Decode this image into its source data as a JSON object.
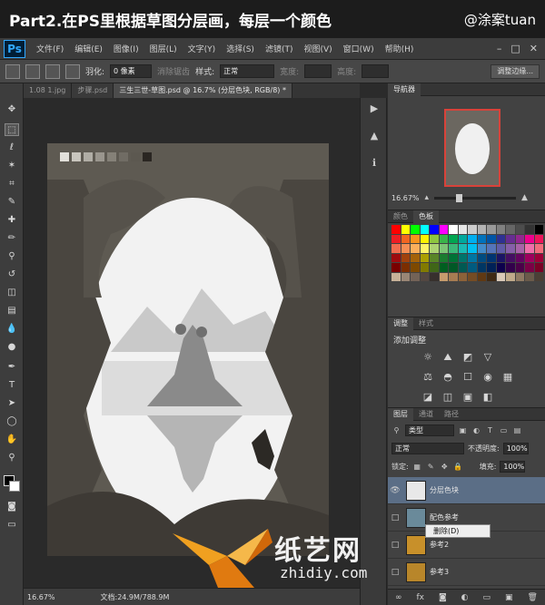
{
  "caption": {
    "title": "Part2.在PS里根据草图分层画，每层一个颜色",
    "author": "@涂案tuan"
  },
  "menubar": {
    "logo": "Ps",
    "items": [
      "文件(F)",
      "编辑(E)",
      "图像(I)",
      "图层(L)",
      "文字(Y)",
      "选择(S)",
      "滤镜(T)",
      "视图(V)",
      "窗口(W)",
      "帮助(H)"
    ]
  },
  "options": {
    "feather_label": "羽化:",
    "feather_value": "0 像素",
    "antialias": "消除锯齿",
    "style_label": "样式:",
    "style_value": "正常",
    "width_label": "宽度:",
    "height_label": "高度:",
    "refine_button": "调整边缘..."
  },
  "tabs": [
    {
      "label": "1.08 1.jpg",
      "active": false
    },
    {
      "label": "步骤.psd",
      "active": false
    },
    {
      "label": "三生三世-草图.psd @ 16.7% (分层色块, RGB/8) *",
      "active": true
    }
  ],
  "status": {
    "zoom": "16.67%",
    "doc": "文档:24.9M/788.9M"
  },
  "navigator": {
    "tab": "导航器",
    "zoom": "16.67%"
  },
  "swatch_panel": {
    "tabs": [
      {
        "label": "颜色",
        "active": false
      },
      {
        "label": "色板",
        "active": true
      }
    ],
    "colors": [
      "#ff0000",
      "#ffff00",
      "#00ff00",
      "#00ffff",
      "#0000ff",
      "#ff00ff",
      "#ffffff",
      "#e6e6e6",
      "#cccccc",
      "#b3b3b3",
      "#999999",
      "#808080",
      "#666666",
      "#4d4d4d",
      "#333333",
      "#000000",
      "#ee1d24",
      "#f26522",
      "#f7941d",
      "#fff200",
      "#8dc63f",
      "#39b54a",
      "#00a651",
      "#00a99d",
      "#00aeef",
      "#0072bc",
      "#0054a6",
      "#2e3192",
      "#662d91",
      "#92278f",
      "#ec008c",
      "#ed145b",
      "#f26c4f",
      "#f68e55",
      "#fbaf5c",
      "#fff467",
      "#acd372",
      "#7cc576",
      "#3bb878",
      "#1abbb4",
      "#00bff3",
      "#438ccb",
      "#5574b9",
      "#605ca8",
      "#855fa8",
      "#a763a8",
      "#f06eaa",
      "#f26d7d",
      "#9e0b0f",
      "#a0410d",
      "#a36209",
      "#aba000",
      "#598527",
      "#1a7b30",
      "#007236",
      "#00746b",
      "#0076a3",
      "#004b80",
      "#003471",
      "#1b1464",
      "#440e62",
      "#630460",
      "#9e005d",
      "#9e0039",
      "#790000",
      "#7b2e00",
      "#7d4900",
      "#827b00",
      "#406618",
      "#005e20",
      "#005826",
      "#005952",
      "#005b7f",
      "#003663",
      "#002157",
      "#0d004c",
      "#32004b",
      "#4b0049",
      "#7b0046",
      "#7a0026",
      "#c7b299",
      "#998675",
      "#736357",
      "#534741",
      "#37302d",
      "#c69c6d",
      "#a67c52",
      "#8c6239",
      "#754c24",
      "#603913",
      "#3f2a14",
      "#d9c9b8",
      "#bfa98a",
      "#8f7a63",
      "#6a5a4a",
      "#4b3f35"
    ]
  },
  "adjustments": {
    "tabs": [
      {
        "label": "调整",
        "active": true
      },
      {
        "label": "样式",
        "active": false
      }
    ],
    "title": "添加调整",
    "icons": [
      "☼",
      "⛰",
      "◩",
      "▽",
      "",
      "⚖",
      "◓",
      "☐",
      "◉",
      "▦",
      "",
      "",
      "◪",
      "◫",
      "▣",
      "◧",
      "",
      "",
      "",
      ""
    ]
  },
  "layers": {
    "tabs": [
      {
        "label": "图层",
        "active": true
      },
      {
        "label": "通道",
        "active": false
      },
      {
        "label": "路径",
        "active": false
      }
    ],
    "filter_label": "类型",
    "blend_mode": "正常",
    "opacity_label": "不透明度:",
    "opacity_value": "100%",
    "lock_label": "锁定:",
    "fill_label": "填充:",
    "fill_value": "100%",
    "rows": [
      {
        "name": "分层色块",
        "visible": true,
        "selected": true,
        "thumb": "#e8e8e8"
      },
      {
        "name": "配色参考",
        "visible": false,
        "selected": false,
        "thumb": "#6a8a9a"
      },
      {
        "name": "参考2",
        "visible": false,
        "selected": false,
        "thumb": "#c8902a"
      },
      {
        "name": "参考3",
        "visible": false,
        "selected": false,
        "thumb": "#b8862a"
      }
    ],
    "context_menu": "删除(D)"
  },
  "canvas": {
    "palette_chips": [
      "#e2e0da",
      "#c9c6be",
      "#b0ada5",
      "#9a968e",
      "#858178",
      "#706c64",
      "#5c5850",
      "#2a2622"
    ]
  },
  "watermark": {
    "name": "纸艺网",
    "url": "zhidiy.com"
  }
}
